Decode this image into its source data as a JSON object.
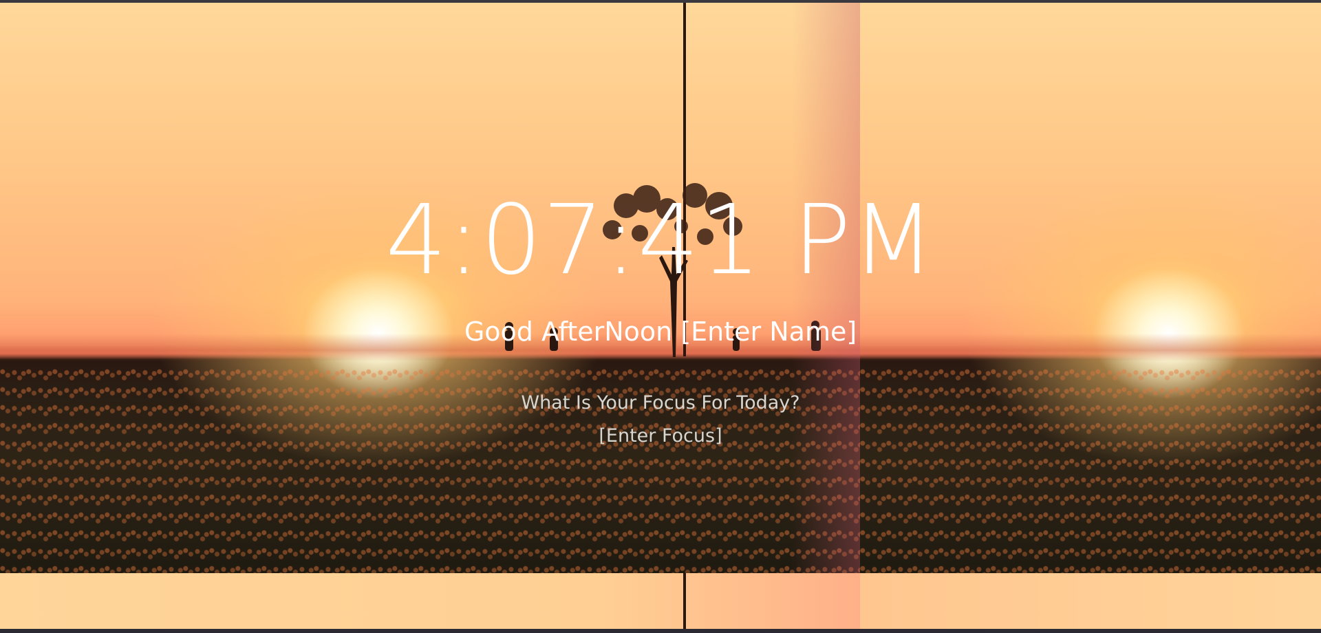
{
  "clock": {
    "time": "4:07:41 PM"
  },
  "greeting": {
    "prefix": "Good AfterNoon",
    "name_placeholder": "[Enter Name]"
  },
  "focus": {
    "question": "What Is Your Focus For Today?",
    "value_placeholder": "[Enter Focus]"
  },
  "background": {
    "image": "sunset-field-icon",
    "sky_color": "#ffc686",
    "ground_color": "#2a1e14"
  }
}
